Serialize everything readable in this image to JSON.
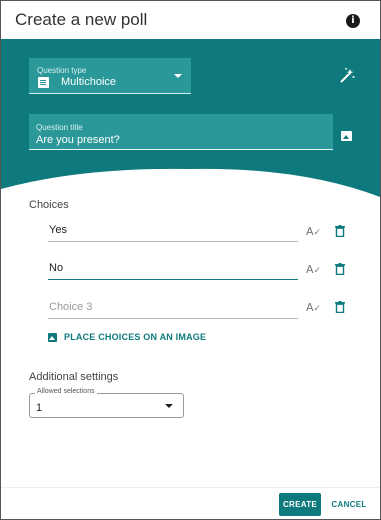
{
  "dialog": {
    "title": "Create a new poll"
  },
  "question": {
    "type_label": "Question type",
    "type_value": "Multichoice",
    "title_label": "Question title",
    "title_value": "Are you present?"
  },
  "choices": {
    "label": "Choices",
    "items": [
      {
        "value": "Yes",
        "placeholder": ""
      },
      {
        "value": "No",
        "placeholder": ""
      },
      {
        "value": "",
        "placeholder": "Choice 3"
      }
    ],
    "place_on_image": "PLACE CHOICES ON AN IMAGE"
  },
  "settings": {
    "label": "Additional settings",
    "allowed_label": "Allowed selections",
    "allowed_value": "1"
  },
  "actions": {
    "create": "CREATE",
    "cancel": "CANCEL"
  },
  "colors": {
    "primary": "#0e7a7d",
    "field_fill": "#2a9799"
  },
  "icons": [
    "info-icon",
    "list-icon",
    "chevron-down-icon",
    "magic-wand-icon",
    "image-icon",
    "spellcheck-icon",
    "trash-icon"
  ]
}
